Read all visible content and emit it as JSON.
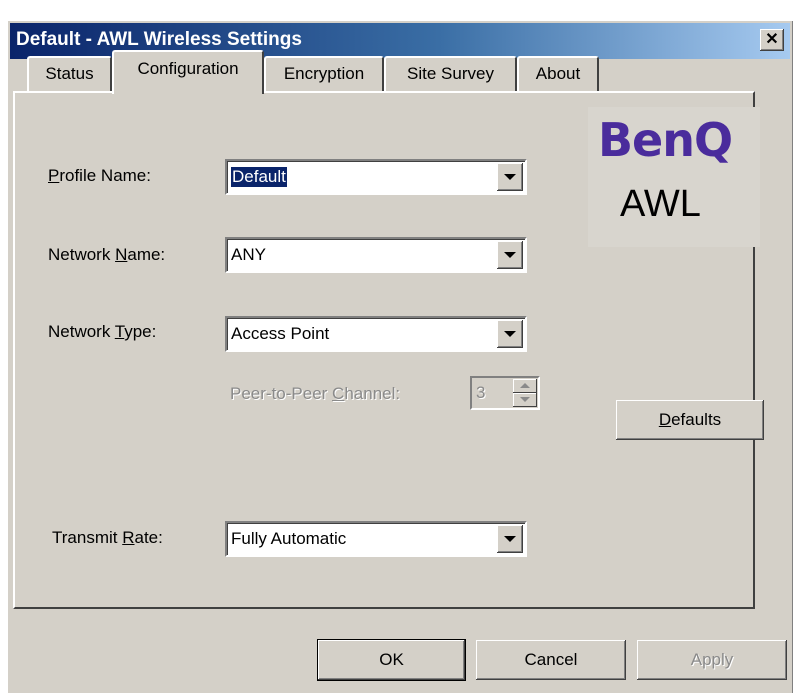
{
  "window": {
    "title": "Default - AWL Wireless Settings",
    "close_glyph": "✕"
  },
  "tabs": [
    {
      "label": "Status",
      "active": false
    },
    {
      "label": "Configuration",
      "active": true
    },
    {
      "label": "Encryption",
      "active": false
    },
    {
      "label": "Site Survey",
      "active": false
    },
    {
      "label": "About",
      "active": false
    }
  ],
  "logo": {
    "brand": "BenQ",
    "product": "AWL",
    "brand_color": "#4a2c9c"
  },
  "fields": {
    "profile_name": {
      "label_pre": "",
      "label_accel": "P",
      "label_post": "rofile Name:",
      "value": "Default"
    },
    "network_name": {
      "label_pre": "Network ",
      "label_accel": "N",
      "label_post": "ame:",
      "value": "ANY"
    },
    "network_type": {
      "label_pre": "Network ",
      "label_accel": "T",
      "label_post": "ype:",
      "value": "Access Point"
    },
    "peer_channel": {
      "label_pre": "Peer-to-Peer ",
      "label_accel": "C",
      "label_post": "hannel:",
      "value": "3"
    },
    "transmit_rate": {
      "label_pre": "Transmit ",
      "label_accel": "R",
      "label_post": "ate:",
      "value": "Fully Automatic"
    }
  },
  "buttons": {
    "defaults_accel": "D",
    "defaults_post": "efaults",
    "ok": "OK",
    "cancel": "Cancel",
    "apply": "Apply"
  },
  "colors": {
    "titlebar_start": "#0a246a",
    "face": "#d4d0c8"
  }
}
